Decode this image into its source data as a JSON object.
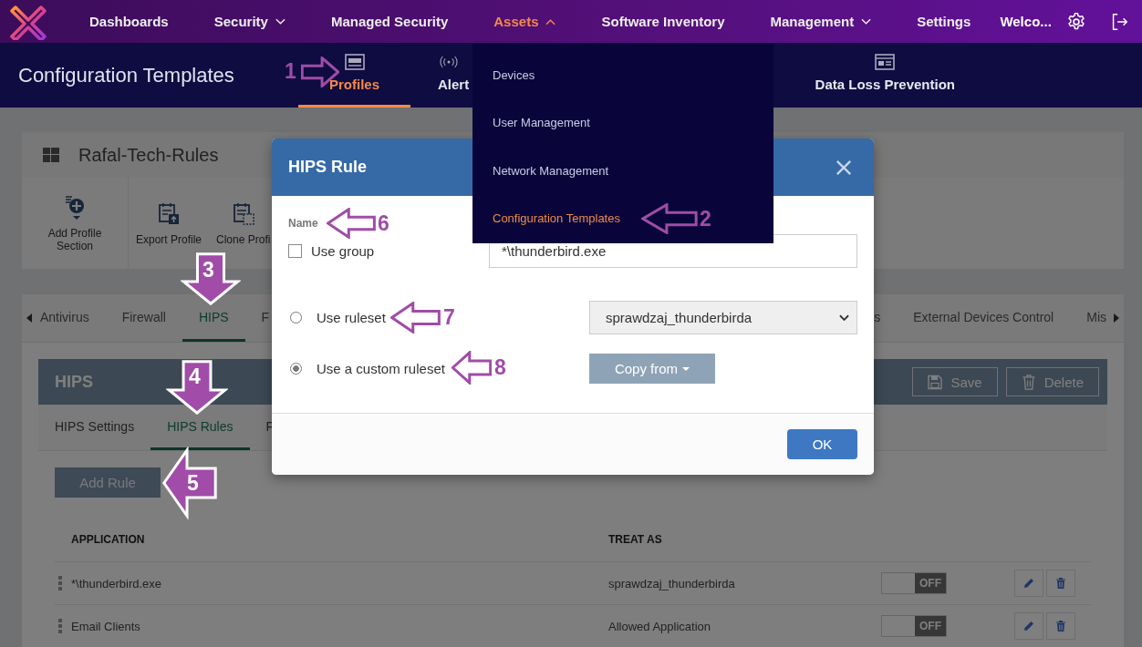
{
  "nav": {
    "items": [
      {
        "label": "Dashboards",
        "has_menu": false,
        "selected": false
      },
      {
        "label": "Security",
        "has_menu": true,
        "selected": false
      },
      {
        "label": "Managed Security",
        "has_menu": false,
        "selected": false
      },
      {
        "label": "Assets",
        "has_menu": true,
        "selected": true
      },
      {
        "label": "Software Inventory",
        "has_menu": false,
        "selected": false
      },
      {
        "label": "Management",
        "has_menu": true,
        "selected": false
      },
      {
        "label": "Settings",
        "has_menu": false,
        "selected": false
      }
    ],
    "user": "Welco..."
  },
  "subheader": {
    "title": "Configuration Templates",
    "tabs": [
      {
        "label": "Profiles",
        "kind": "window",
        "selected": true
      },
      {
        "label": "Alert",
        "kind": "broadcast",
        "selected": false
      },
      {
        "label": "Data Loss Prevention",
        "kind": "panel",
        "selected": false
      }
    ]
  },
  "assets_menu": {
    "items": [
      {
        "label": "Devices",
        "selected": false
      },
      {
        "label": "User Management",
        "selected": false
      },
      {
        "label": "Network Management",
        "selected": false
      },
      {
        "label": "Configuration Templates",
        "selected": true
      }
    ]
  },
  "profile": {
    "name": "Rafal-Tech-Rules",
    "toolbar": [
      {
        "label": "Add Profile Section",
        "kind": "add"
      },
      {
        "label": "Export Profile",
        "kind": "export"
      },
      {
        "label": "Clone Profi",
        "kind": "clone"
      }
    ],
    "section_tabs": {
      "left": [
        {
          "label": "Antivirus",
          "selected": false
        },
        {
          "label": "Firewall",
          "selected": false
        },
        {
          "label": "HIPS",
          "selected": true
        },
        {
          "label": "F",
          "selected": false
        }
      ],
      "right": [
        {
          "label": "s",
          "selected": false
        },
        {
          "label": "External Devices Control",
          "selected": false
        },
        {
          "label": "Mis",
          "selected": false
        }
      ]
    }
  },
  "hips": {
    "title": "HIPS",
    "actions": [
      {
        "label": "Save",
        "kind": "save"
      },
      {
        "label": "Delete",
        "kind": "delete"
      }
    ],
    "tabs": [
      {
        "label": "HIPS Settings",
        "selected": false
      },
      {
        "label": "HIPS Rules",
        "selected": true
      },
      {
        "label": "F",
        "selected": false
      }
    ],
    "add_button": "Add Rule",
    "table": {
      "columns": [
        "APPLICATION",
        "TREAT AS"
      ],
      "rows": [
        {
          "application": "*\\thunderbird.exe",
          "treat_as": "sprawdzaj_thunderbirda",
          "on": false,
          "toggle_label": "OFF"
        },
        {
          "application": "Email Clients",
          "treat_as": "Allowed Application",
          "on": false,
          "toggle_label": "OFF"
        }
      ]
    }
  },
  "dialog": {
    "title": "HIPS Rule",
    "name_label": "Name",
    "use_group": {
      "label": "Use group",
      "checked": false
    },
    "name_value": "*\\thunderbird.exe",
    "options": [
      {
        "label": "Use ruleset",
        "selected": false
      },
      {
        "label": "Use a custom ruleset",
        "selected": true
      }
    ],
    "ruleset_value": "sprawdzaj_thunderbirda",
    "copy_button": "Copy from",
    "ok_button": "OK"
  },
  "annotations": [
    {
      "number": "1",
      "kind": "outline"
    },
    {
      "number": "2",
      "kind": "outline"
    },
    {
      "number": "3",
      "kind": "filled"
    },
    {
      "number": "4",
      "kind": "filled"
    },
    {
      "number": "5",
      "kind": "filled"
    },
    {
      "number": "6",
      "kind": "outline"
    },
    {
      "number": "7",
      "kind": "outline"
    },
    {
      "number": "8",
      "kind": "outline"
    }
  ]
}
